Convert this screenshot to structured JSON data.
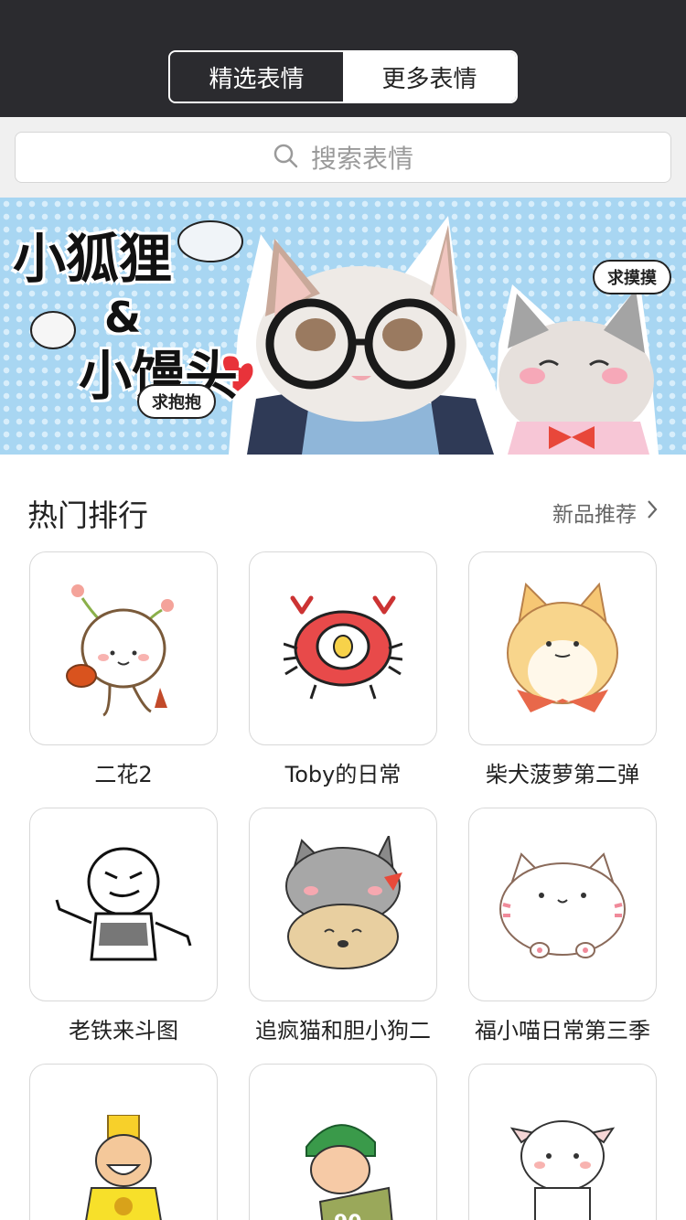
{
  "header": {
    "tabs": [
      {
        "label": "精选表情",
        "active": true
      },
      {
        "label": "更多表情",
        "active": false
      }
    ]
  },
  "search": {
    "placeholder": "搜索表情",
    "icon": "search-icon"
  },
  "banner": {
    "title_line1": "小狐狸",
    "title_amp": "&",
    "title_line2": "小馒头",
    "bubble_left": "求抱抱",
    "bubble_right": "求摸摸"
  },
  "hot": {
    "title": "热门排行",
    "more_label": "新品推荐",
    "items": [
      {
        "name": "二花2"
      },
      {
        "name": "Toby的日常"
      },
      {
        "name": "柴犬菠萝第二弹"
      },
      {
        "name": "老铁来斗图"
      },
      {
        "name": "追疯猫和胆小狗二"
      },
      {
        "name": "福小喵日常第三季"
      },
      {
        "name": ""
      },
      {
        "name": ""
      },
      {
        "name": ""
      }
    ]
  },
  "colors": {
    "header_bg": "#2b2b2f",
    "banner_bg": "#a8d6f2",
    "accent_red": "#e84a4a"
  }
}
